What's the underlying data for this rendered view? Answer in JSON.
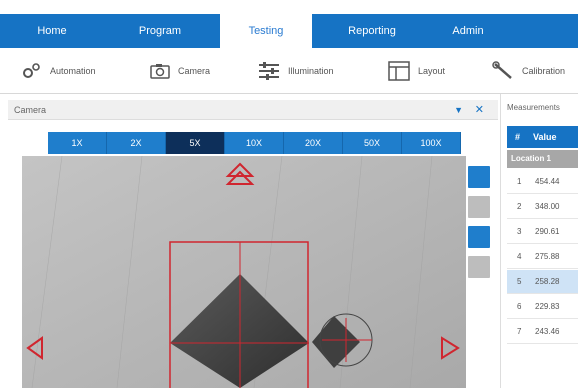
{
  "nav": {
    "tabs": [
      {
        "label": "Home",
        "active": false
      },
      {
        "label": "Program",
        "active": false
      },
      {
        "label": "Testing",
        "active": true
      },
      {
        "label": "Reporting",
        "active": false
      },
      {
        "label": "Admin",
        "active": false
      }
    ]
  },
  "toolbar": {
    "items": [
      {
        "label": "Automation",
        "icon": "automation-icon"
      },
      {
        "label": "Camera",
        "icon": "camera-icon"
      },
      {
        "label": "Illumination",
        "icon": "illumination-icon"
      },
      {
        "label": "Layout",
        "icon": "layout-icon"
      },
      {
        "label": "Calibration",
        "icon": "calibration-icon"
      }
    ]
  },
  "camera_panel": {
    "title": "Camera",
    "zoom_levels": [
      "1X",
      "2X",
      "5X",
      "10X",
      "20X",
      "50X",
      "100X"
    ],
    "active_zoom": "5X"
  },
  "measurements": {
    "title": "Measurements",
    "columns": [
      "#",
      "Value"
    ],
    "group": "Location 1",
    "rows": [
      {
        "n": "1",
        "value": "454.44",
        "selected": false
      },
      {
        "n": "2",
        "value": "348.00",
        "selected": false
      },
      {
        "n": "3",
        "value": "290.61",
        "selected": false
      },
      {
        "n": "4",
        "value": "275.88",
        "selected": false
      },
      {
        "n": "5",
        "value": "258.28",
        "selected": true
      },
      {
        "n": "6",
        "value": "229.83",
        "selected": false
      },
      {
        "n": "7",
        "value": "243.46",
        "selected": false
      }
    ]
  },
  "colors": {
    "accent": "#1673c4",
    "active_zoom": "#0d2f5a",
    "overlay_red": "#d0262f"
  }
}
